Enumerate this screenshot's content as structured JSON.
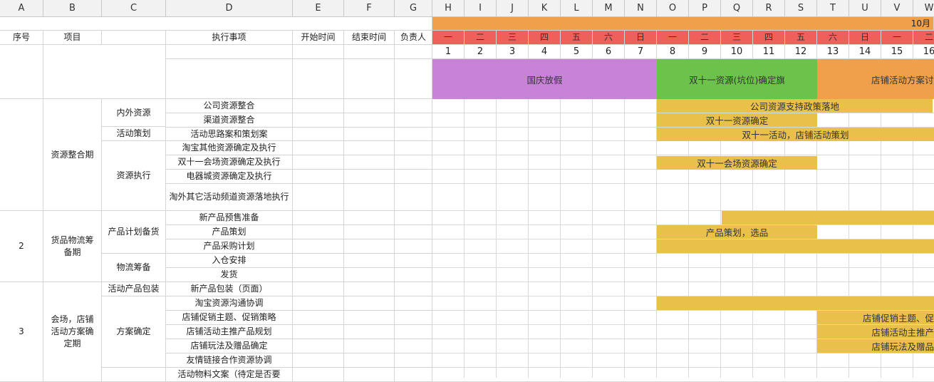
{
  "columns": [
    "A",
    "B",
    "C",
    "D",
    "E",
    "F",
    "G",
    "H",
    "I",
    "J",
    "K",
    "L",
    "M",
    "N",
    "O",
    "P",
    "Q",
    "R",
    "S",
    "T",
    "U",
    "V",
    "W"
  ],
  "header": {
    "seq": "序号",
    "project": "项目",
    "task": "执行事项",
    "start": "开始时间",
    "end": "结束时间",
    "owner": "负责人",
    "month": "10月"
  },
  "weekdays": [
    "一",
    "二",
    "三",
    "四",
    "五",
    "六",
    "日",
    "一",
    "二",
    "三",
    "四",
    "五",
    "六",
    "日",
    "一",
    "二"
  ],
  "days": [
    "1",
    "2",
    "3",
    "4",
    "5",
    "6",
    "7",
    "8",
    "9",
    "10",
    "11",
    "12",
    "13",
    "14",
    "15",
    "16"
  ],
  "phases": [
    {
      "label": "国庆放假",
      "color": "#c882d8"
    },
    {
      "label": "双十一资源(坑位)确定旗",
      "color": "#6cc24a"
    },
    {
      "label": "店铺活动方案讨",
      "color": "#f0a04a"
    }
  ],
  "stages": [
    {
      "seq": "",
      "name": "资源整合期"
    },
    {
      "seq": "2",
      "name": "货品物流筹备期"
    },
    {
      "seq": "3",
      "name": "会场，店铺活动方案确定期"
    }
  ],
  "subgroups": [
    "内外资源",
    "活动策划",
    "资源执行",
    "产品计划备货",
    "物流筹备",
    "活动产品包装",
    "方案确定"
  ],
  "tasks": [
    "公司资源整合",
    "渠道资源整合",
    "活动思路案和策划案",
    "淘宝其他资源确定及执行",
    "双十一会场资源确定及执行",
    "电器城资源确定及执行",
    "淘外其它活动频道资源落地执行",
    "新产品预售准备",
    "产品策划",
    "产品采购计划",
    "入仓安排",
    "发货",
    "新产品包装（页面）",
    "淘宝资源沟通协调",
    "店铺促销主题、促销策略",
    "店铺活动主推产品规划",
    "店铺玩法及赠品确定",
    "友情链接合作资源协调",
    "活动物料文案（待定是否要"
  ],
  "bars": [
    "公司资源支持政策落地",
    "双十一资源确定",
    "双十一活动，店铺活动策划",
    "双十一会场资源确定",
    "",
    "产品策划，选品",
    "",
    "",
    "店铺促销主题、促",
    "店铺活动主推产",
    "店铺玩法及赠品"
  ],
  "colors": {
    "bar": "#e9c04a",
    "weekday_header": "#f0605a",
    "month_header": "#f0a04a"
  }
}
